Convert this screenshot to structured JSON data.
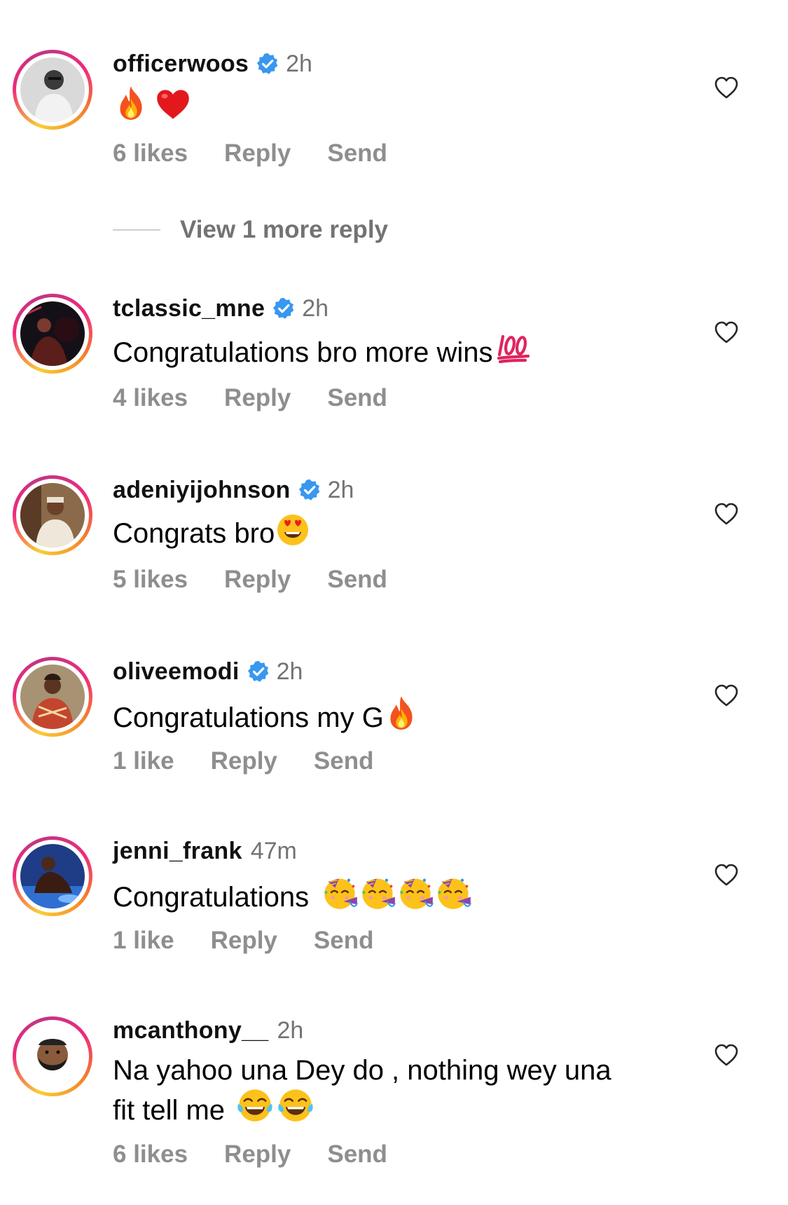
{
  "comments": [
    {
      "username": "officerwoos",
      "verified": true,
      "time": "2h",
      "text": "",
      "emojis": [
        "fire-emoji",
        "red-heart-emoji"
      ],
      "likes": "6 likes",
      "reply": "Reply",
      "send": "Send"
    },
    {
      "username": "tclassic_mne",
      "verified": true,
      "time": "2h",
      "text": "Congratulations bro more wins",
      "emojis": [
        "hundred-points-emoji"
      ],
      "likes": "4 likes",
      "reply": "Reply",
      "send": "Send"
    },
    {
      "username": "adeniyijohnson",
      "verified": true,
      "time": "2h",
      "text": "Congrats bro",
      "emojis": [
        "heart-eyes-emoji"
      ],
      "likes": "5 likes",
      "reply": "Reply",
      "send": "Send"
    },
    {
      "username": "oliveemodi",
      "verified": true,
      "time": "2h",
      "text": "Congratulations my G",
      "emojis": [
        "fire-emoji"
      ],
      "likes": "1 like",
      "reply": "Reply",
      "send": "Send"
    },
    {
      "username": "jenni_frank",
      "verified": false,
      "time": "47m",
      "text": "Congratulations ",
      "emojis": [
        "partying-face-emoji",
        "partying-face-emoji",
        "partying-face-emoji",
        "partying-face-emoji"
      ],
      "likes": "1 like",
      "reply": "Reply",
      "send": "Send"
    },
    {
      "username": "mcanthony__",
      "verified": false,
      "time": "2h",
      "text_line1": "Na yahoo una Dey do , nothing wey una",
      "text_line2": "fit tell me ",
      "emojis": [
        "tears-of-joy-emoji",
        "tears-of-joy-emoji"
      ],
      "likes": "6 likes",
      "reply": "Reply",
      "send": "Send"
    }
  ],
  "view_more_replies": "View 1 more reply",
  "colors": {
    "verified_blue": "#3897f0",
    "muted_text": "#8e8e8e",
    "time_text": "#737373"
  }
}
